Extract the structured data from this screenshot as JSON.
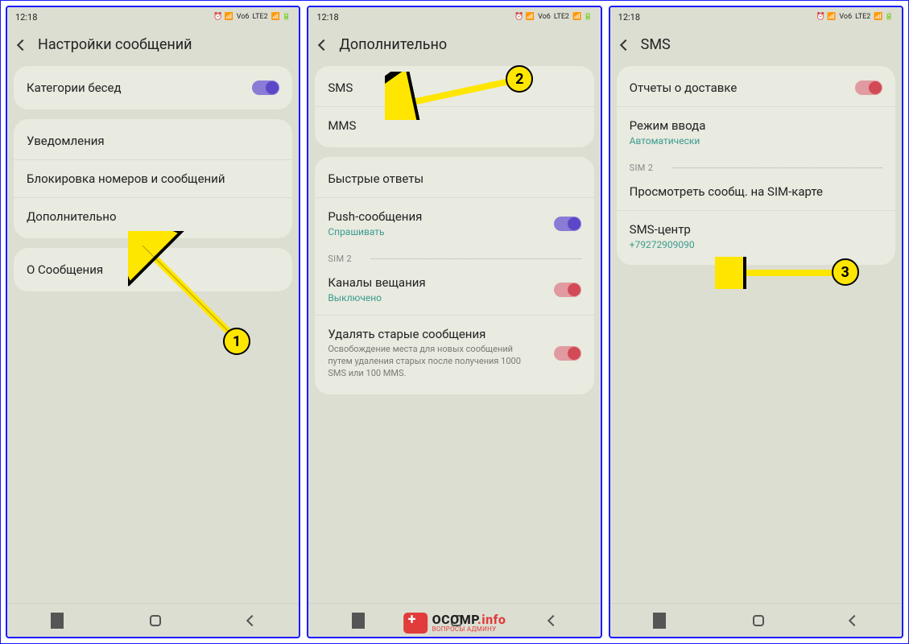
{
  "statusbar": {
    "time": "12:18",
    "lte": "LTE2",
    "vo": "Vo6"
  },
  "screen1": {
    "title": "Настройки сообщений",
    "items": {
      "categories": "Категории бесед",
      "notifications": "Уведомления",
      "blocking": "Блокировка номеров и сообщений",
      "more": "Дополнительно",
      "about": "О Сообщения"
    }
  },
  "screen2": {
    "title": "Дополнительно",
    "items": {
      "sms": "SMS",
      "mms": "MMS",
      "quick": "Быстрые ответы",
      "push": "Push-сообщения",
      "push_sub": "Спрашивать",
      "sim": "SIM 2",
      "channels": "Каналы вещания",
      "channels_sub": "Выключено",
      "delete_old": "Удалять старые сообщения",
      "delete_desc": "Освобождение места для новых сообщений путем удаления старых после получения 1000 SMS или 100 MMS."
    }
  },
  "screen3": {
    "title": "SMS",
    "items": {
      "delivery": "Отчеты о доставке",
      "input_mode": "Режим ввода",
      "input_sub": "Автоматически",
      "sim": "SIM 2",
      "view_sim": "Просмотреть сообщ. на SIM-карте",
      "sms_center": "SMS-центр",
      "sms_center_num": "+79272909090"
    }
  },
  "annotations": {
    "n1": "1",
    "n2": "2",
    "n3": "3"
  },
  "watermark": {
    "main1": "OCOMP",
    "main2": ".info",
    "sub": "ВОПРОСЫ АДМИНУ"
  }
}
